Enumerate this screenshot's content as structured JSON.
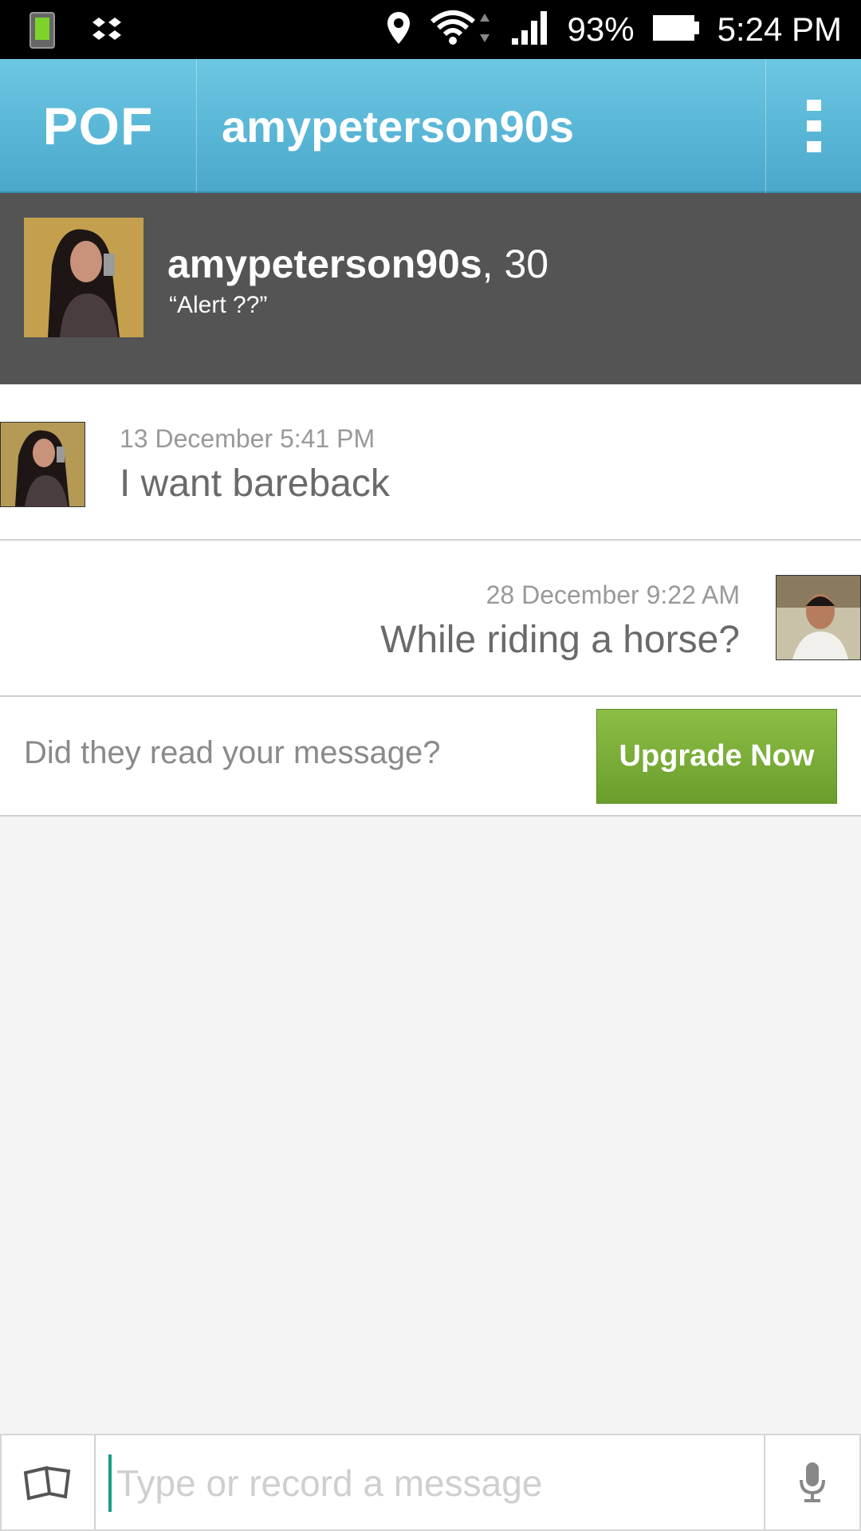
{
  "status_bar": {
    "battery_percent": "93%",
    "time": "5:24 PM",
    "icons": [
      "phone-icon",
      "dropbox-icon",
      "location-icon",
      "wifi-icon",
      "signal-icon",
      "battery-icon"
    ]
  },
  "action_bar": {
    "logo": "POF",
    "title": "amypeterson90s",
    "overflow_icon": "overflow-menu-icon"
  },
  "profile": {
    "username": "amypeterson90s",
    "age_suffix": ", 30",
    "headline": "“Alert ??”"
  },
  "messages": [
    {
      "time": "13 December 5:41 PM",
      "text": "I want bareback",
      "side": "left"
    },
    {
      "time": "28 December 9:22 AM",
      "text": "While riding a horse?",
      "side": "right"
    }
  ],
  "upsell": {
    "text": "Did they read your message?",
    "button_label": "Upgrade Now"
  },
  "composer": {
    "placeholder": "Type or record a message"
  },
  "colors": {
    "action_bar_top": "#6cc7e3",
    "action_bar_bottom": "#4aa8cb",
    "profile_bg": "#545454",
    "upgrade_green": "#7cb03a",
    "cursor_teal": "#1a9c8a"
  }
}
